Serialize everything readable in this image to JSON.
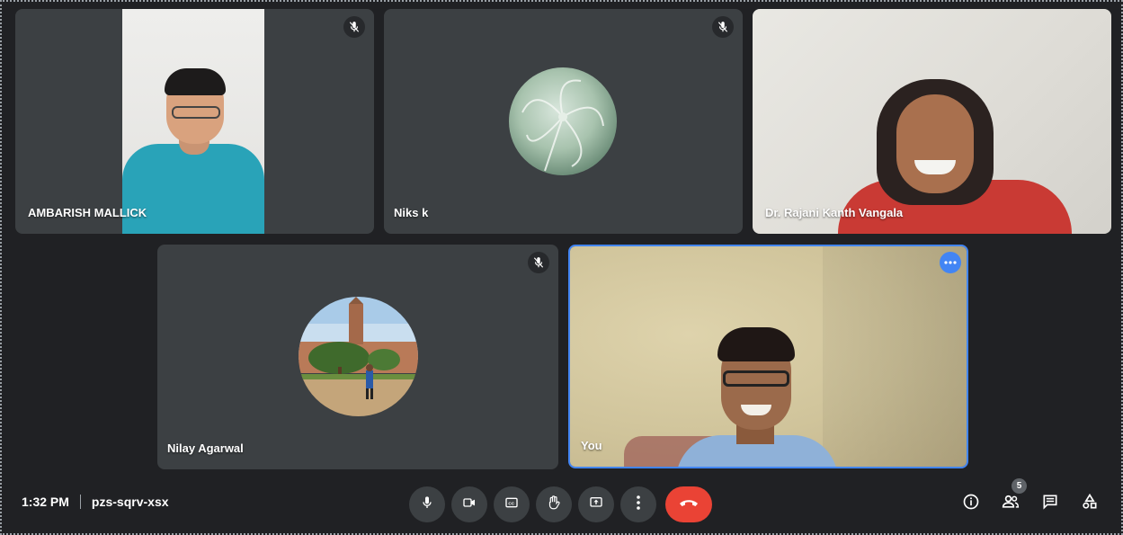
{
  "participants": {
    "tile1": {
      "name": "AMBARISH MALLICK",
      "muted": true
    },
    "tile2": {
      "name": "Niks k",
      "muted": true
    },
    "tile3": {
      "name": "Dr. Rajani Kanth Vangala",
      "muted": false
    },
    "tile4": {
      "name": "Nilay Agarwal",
      "muted": true
    },
    "tile5": {
      "name": "You",
      "muted": false
    }
  },
  "meeting": {
    "time": "1:32 PM",
    "code": "pzs-sqrv-xsx"
  },
  "controls": {
    "center": [
      "mic-icon",
      "camera-icon",
      "captions-icon",
      "raise-hand-icon",
      "present-icon",
      "more-options-icon",
      "end-call-icon"
    ],
    "right": [
      "info-icon",
      "people-icon",
      "chat-icon",
      "activities-icon"
    ]
  },
  "participant_count": "5",
  "colors": {
    "background": "#202124",
    "tile": "#3c4043",
    "active_speaker": "#4285f4",
    "end_call": "#ea4335"
  }
}
